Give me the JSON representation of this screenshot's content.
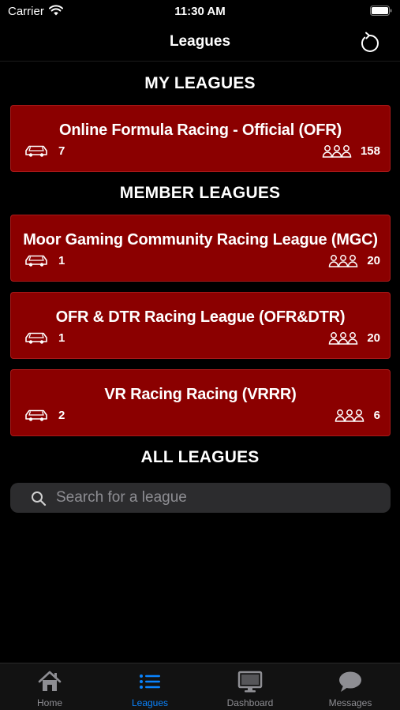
{
  "status_bar": {
    "carrier": "Carrier",
    "time": "11:30 AM"
  },
  "nav": {
    "title": "Leagues"
  },
  "sections": {
    "my_leagues": "MY LEAGUES",
    "member_leagues": "MEMBER LEAGUES",
    "all_leagues": "ALL LEAGUES"
  },
  "my_leagues": [
    {
      "name": "Online Formula Racing - Official (OFR)",
      "races": "7",
      "members": "158"
    }
  ],
  "member_leagues": [
    {
      "name": "Moor Gaming Community Racing League  (MGC)",
      "races": "1",
      "members": "20"
    },
    {
      "name": "OFR & DTR Racing League (OFR&DTR)",
      "races": "1",
      "members": "20"
    },
    {
      "name": "VR Racing Racing (VRRR)",
      "races": "2",
      "members": "6"
    }
  ],
  "search": {
    "placeholder": "Search for a league",
    "value": ""
  },
  "tabs": [
    {
      "label": "Home",
      "icon": "home-icon"
    },
    {
      "label": "Leagues",
      "icon": "list-icon",
      "active": true
    },
    {
      "label": "Dashboard",
      "icon": "monitor-icon"
    },
    {
      "label": "Messages",
      "icon": "chat-bubble-icon"
    }
  ],
  "colors": {
    "card_bg": "#8b0000",
    "accent": "#0a84ff",
    "background": "#000000",
    "search_bg": "#2c2c2e"
  }
}
